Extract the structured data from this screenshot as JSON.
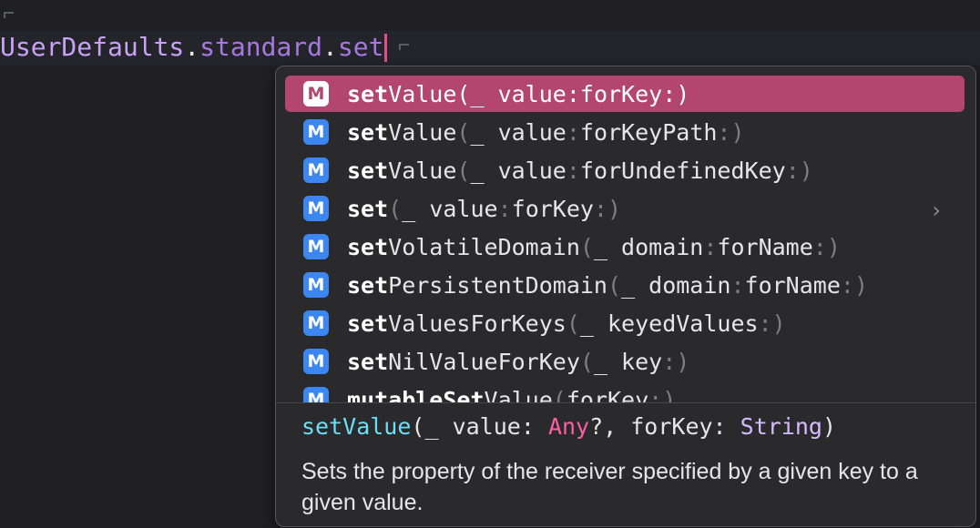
{
  "editor": {
    "code": {
      "type": "UserDefaults",
      "dot1": ".",
      "prop": "standard",
      "dot2": ".",
      "member": "set"
    }
  },
  "completion": {
    "badge_letter": "M",
    "items": [
      {
        "bold": "set",
        "name": "Value",
        "lparen": "(",
        "args": "_ value",
        "c1": ":",
        "label": "forKey",
        "c2": ":",
        "rparen": ")"
      },
      {
        "bold": "set",
        "name": "Value",
        "lparen": "(",
        "args": "_ value",
        "c1": ":",
        "label": "forKeyPath",
        "c2": ":",
        "rparen": ")"
      },
      {
        "bold": "set",
        "name": "Value",
        "lparen": "(",
        "args": "_ value",
        "c1": ":",
        "label": "forUndefinedKey",
        "c2": ":",
        "rparen": ")"
      },
      {
        "bold": "set",
        "name": "",
        "lparen": "(",
        "args": "_ value",
        "c1": ":",
        "label": "forKey",
        "c2": ":",
        "rparen": ")"
      },
      {
        "bold": "set",
        "name": "VolatileDomain",
        "lparen": "(",
        "args": "_ domain",
        "c1": ":",
        "label": "forName",
        "c2": ":",
        "rparen": ")"
      },
      {
        "bold": "set",
        "name": "PersistentDomain",
        "lparen": "(",
        "args": "_ domain",
        "c1": ":",
        "label": "forName",
        "c2": ":",
        "rparen": ")"
      },
      {
        "bold": "set",
        "name": "ValuesForKeys",
        "lparen": "(",
        "args": "_ keyedValues",
        "c1": ":",
        "label": "",
        "c2": "",
        "rparen": ")"
      },
      {
        "bold": "set",
        "name": "NilValueForKey",
        "lparen": "(",
        "args": "_ key",
        "c1": ":",
        "label": "",
        "c2": "",
        "rparen": ")"
      },
      {
        "pre": "mutable",
        "bold": "Set",
        "name": "Value",
        "lparen": "(",
        "args": "forKey",
        "c1": ":",
        "label": "",
        "c2": "",
        "rparen": ")"
      }
    ],
    "chevron": "›",
    "detail": {
      "sig_name": "setValue",
      "sig_open": "(_ value: ",
      "sig_any": "Any",
      "sig_mid": "?, forKey: ",
      "sig_string": "String",
      "sig_close": ")",
      "description": "Sets the property of the receiver specified by a given key to a given value."
    }
  }
}
